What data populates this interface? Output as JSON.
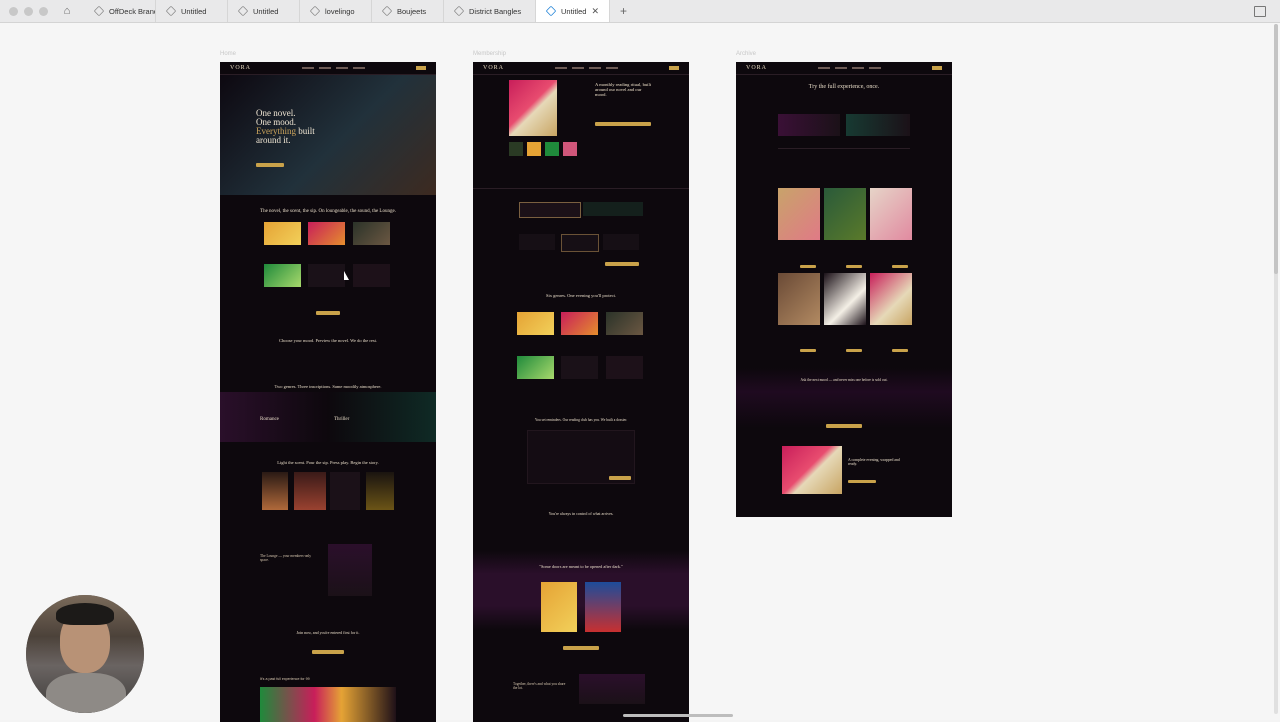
{
  "tabs": [
    {
      "label": "OffDeck Brand 1.0",
      "active": false
    },
    {
      "label": "Untitled",
      "active": false
    },
    {
      "label": "Untitled",
      "active": false
    },
    {
      "label": "lovelingo",
      "active": false
    },
    {
      "label": "Boujeets",
      "active": false
    },
    {
      "label": "District Bangles",
      "active": false
    },
    {
      "label": "Untitled",
      "active": true
    }
  ],
  "frames": [
    {
      "label": "Home",
      "logo": "VORA",
      "hero_line1": "One novel.",
      "hero_line2": "One mood.",
      "hero_gold": "Everything",
      "hero_line3": "built",
      "hero_line4": "around it.",
      "section1": "The novel, the scent, the sip. On loungeable, the sound, the Lounge.",
      "section2": "Choose your mood. Preview the novel. We do the rest.",
      "section3": "Two genres. Three inscriptions. Same moodily atmosphere.",
      "genre1": "Romance",
      "genre2": "Thriller",
      "section4": "Light the scent. Pour the sip. Press play. Begin the story.",
      "section5": "The Lounge — your members-only space.",
      "section6": "Join now, and you're entered first for it.",
      "section7": "It's a past full experience for 99"
    },
    {
      "label": "Membership",
      "logo": "VORA",
      "hero_title": "A monthly reading ritual, built around our novel and our mood.",
      "section1": "Six genres. One evening you'll protect.",
      "section2": "You set reminders. Our reading club has you. We built a dossier.",
      "section3": "You're always in control of what arrives.",
      "section4": "\"Some doors are meant to be opened after dark.\"",
      "section5": "Together, there's and what you share the lot."
    },
    {
      "label": "Archive",
      "logo": "VORA",
      "hero_title": "Try the full experience, once.",
      "section1": "Ask the next mood — and never miss one before is sold out.",
      "section2": "A complete evening, wrapped and ready."
    }
  ],
  "colors": {
    "frame_bg": "#0d080d",
    "gold": "#c9a24a",
    "cream": "#e9dcc2",
    "canvas": "#f6f6f6"
  }
}
